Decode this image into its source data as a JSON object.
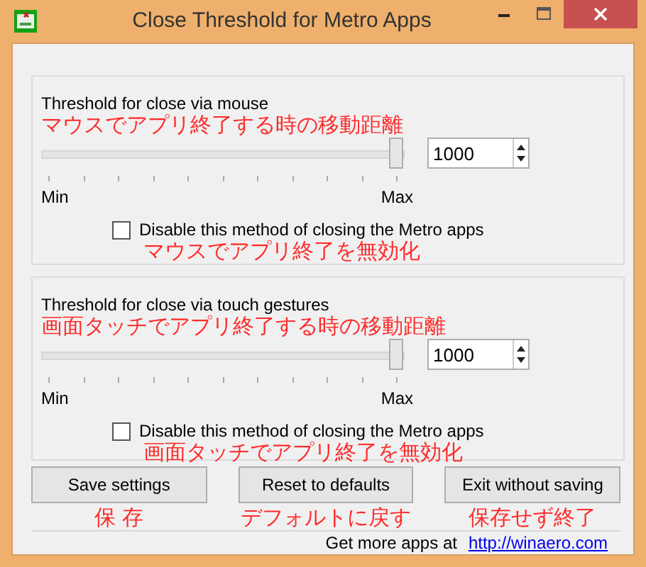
{
  "window": {
    "title": "Close Threshold for Metro Apps"
  },
  "sections": [
    {
      "label": "Threshold for close via mouse",
      "annotation": "マウスでアプリ終了する時の移動距離",
      "level": 1,
      "value": "1000",
      "min": "Min",
      "max": "Max",
      "checkbox": {
        "label": "Disable this method of closing the Metro apps",
        "checked": false,
        "annotation": "マウスでアプリ終了を無効化"
      }
    },
    {
      "label": "Threshold for close via touch gestures",
      "annotation": "画面タッチでアプリ終了する時の移動距離",
      "level": 1,
      "value": "1000",
      "min": "Min",
      "max": "Max",
      "checkbox": {
        "label": "Disable this method of closing the Metro apps",
        "checked": false,
        "annotation": "画面タッチでアプリ終了を無効化"
      }
    }
  ],
  "buttons": [
    {
      "label": "Save settings",
      "annotation": "保 存"
    },
    {
      "label": "Reset to defaults",
      "annotation": "デフォルトに戻す"
    },
    {
      "label": "Exit without saving",
      "annotation": "保存せず終了"
    }
  ],
  "footer": {
    "text": "Get more apps at",
    "link": "http://winaero.com"
  }
}
